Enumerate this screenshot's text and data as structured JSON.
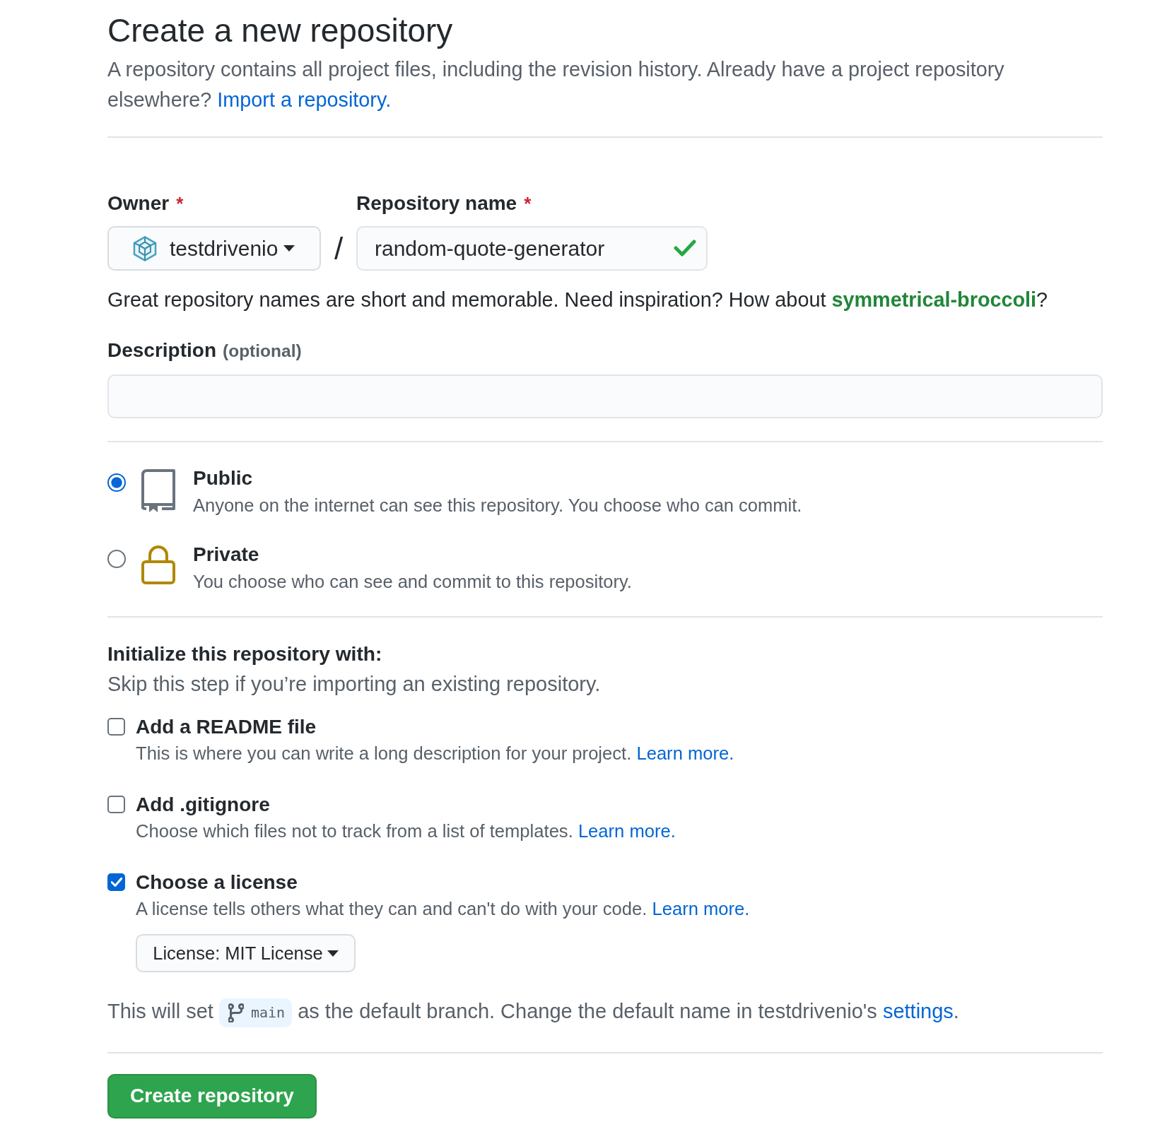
{
  "header": {
    "title": "Create a new repository",
    "description": "A repository contains all project files, including the revision history. Already have a project repository elsewhere?",
    "import_link": "Import a repository."
  },
  "owner": {
    "label": "Owner",
    "required_mark": "*",
    "value": "testdrivenio"
  },
  "separator": "/",
  "repository_name": {
    "label": "Repository name",
    "required_mark": "*",
    "value": "random-quote-generator",
    "valid": true
  },
  "name_hint": {
    "text": "Great repository names are short and memorable. Need inspiration? How about",
    "suggestion": "symmetrical-broccoli",
    "end": "?"
  },
  "description_field": {
    "label": "Description",
    "optional_note": "(optional)"
  },
  "visibility": [
    {
      "kind": "public",
      "title": "Public",
      "description": "Anyone on the internet can see this repository. You choose who can commit.",
      "selected": true
    },
    {
      "kind": "private",
      "title": "Private",
      "description": "You choose who can see and commit to this repository.",
      "selected": false
    }
  ],
  "initialize": {
    "title": "Initialize this repository with:",
    "subtitle": "Skip this step if you’re importing an existing repository.",
    "options": [
      {
        "title": "Add a README file",
        "description": "This is where you can write a long description for your project.",
        "link": "Learn more.",
        "checked": false
      },
      {
        "title": "Add .gitignore",
        "description": "Choose which files not to track from a list of templates.",
        "link": "Learn more.",
        "checked": false
      },
      {
        "title": "Choose a license",
        "description": "A license tells others what they can and can't do with your code.",
        "link": "Learn more.",
        "checked": true,
        "select": "License: MIT License"
      }
    ]
  },
  "default_branch": {
    "before": "This will set",
    "branch": "main",
    "after": "as the default branch. Change the default name in testdrivenio's",
    "link": "settings",
    "end": "."
  },
  "submit_button": "Create repository"
}
